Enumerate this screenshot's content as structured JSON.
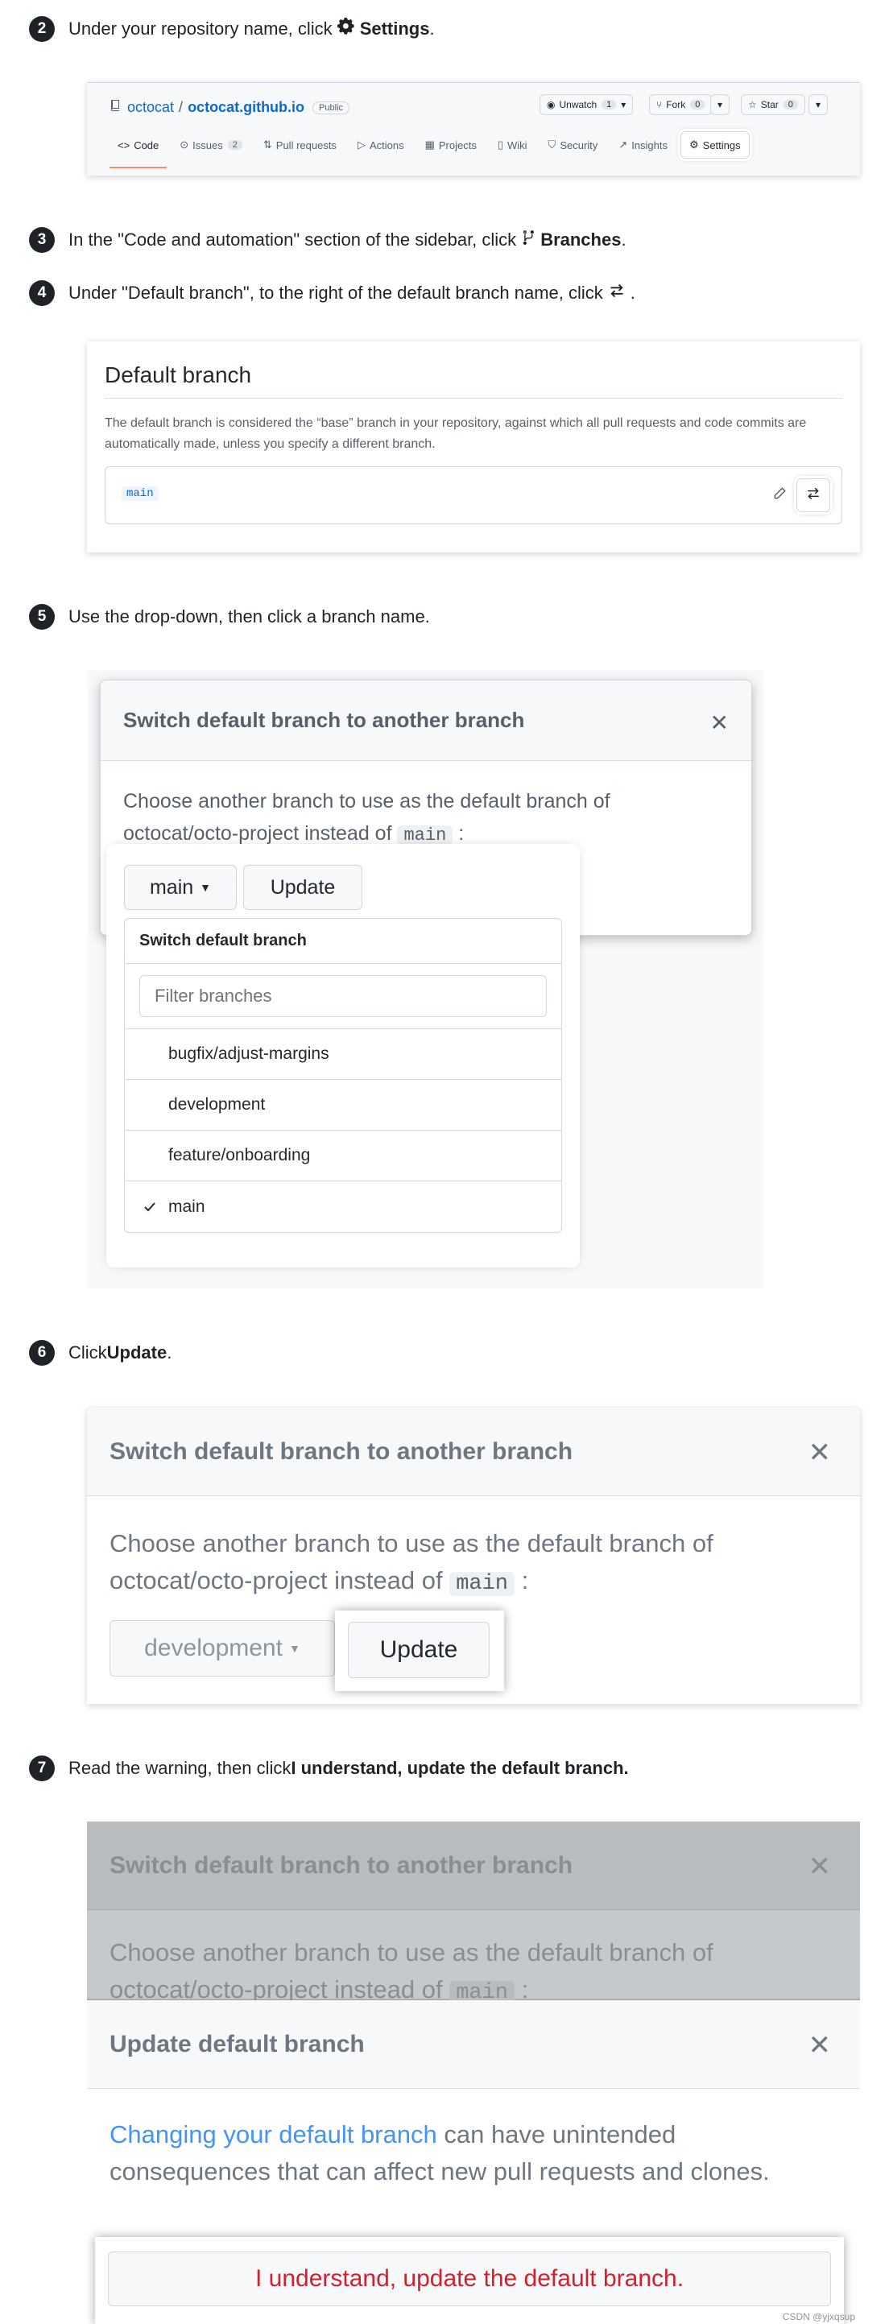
{
  "steps": [
    {
      "num": "2",
      "pre": "Under your repository name, click ",
      "bold": "Settings",
      "post": "."
    },
    {
      "num": "3",
      "pre": "In the \"Code and automation\" section of the sidebar, click ",
      "bold": "Branches",
      "post": "."
    },
    {
      "num": "4",
      "pre": "Under \"Default branch\", to the right of the default branch name, click ",
      "bold": "",
      "post": "."
    },
    {
      "num": "5",
      "pre": "Use the drop-down, then click a branch name.",
      "bold": "",
      "post": ""
    },
    {
      "num": "6",
      "pre": "Click ",
      "bold": "Update",
      "post": "."
    },
    {
      "num": "7",
      "pre": "Read the warning, then click ",
      "bold": "I understand, update the default branch.",
      "post": ""
    }
  ],
  "repo": {
    "owner": "octocat",
    "name": "octocat.github.io",
    "visibility": "Public",
    "unwatch_label": "Unwatch",
    "unwatch_count": "1",
    "fork_label": "Fork",
    "fork_count": "0",
    "star_label": "Star",
    "star_count": "0",
    "tabs": [
      {
        "label": "Code",
        "count": ""
      },
      {
        "label": "Issues",
        "count": "2"
      },
      {
        "label": "Pull requests",
        "count": ""
      },
      {
        "label": "Actions",
        "count": ""
      },
      {
        "label": "Projects",
        "count": ""
      },
      {
        "label": "Wiki",
        "count": ""
      },
      {
        "label": "Security",
        "count": ""
      },
      {
        "label": "Insights",
        "count": ""
      },
      {
        "label": "Settings",
        "count": ""
      }
    ]
  },
  "default_branch": {
    "heading": "Default branch",
    "description": "The default branch is considered the “base” branch in your repository, against which all pull requests and code commits are automatically made, unless you specify a different branch.",
    "branch": "main"
  },
  "switch_modal": {
    "title": "Switch default branch to another branch",
    "body_pre": "Choose another branch to use as the default branch of octocat/octo-project instead of ",
    "current": "main",
    "body_post": ":",
    "branch_button": "main",
    "update_button": "Update",
    "menu_title": "Switch default branch",
    "filter_placeholder": "Filter branches",
    "branches": [
      "bugfix/adjust-margins",
      "development",
      "feature/onboarding",
      "main"
    ]
  },
  "update_step": {
    "selected_branch": "development",
    "update_button": "Update"
  },
  "warning_modal": {
    "title": "Update default branch",
    "link_text": "Changing your default branch",
    "body": " can have unintended consequences that can affect new pull requests and clones.",
    "confirm_button": "I understand, update the default branch."
  },
  "watermark": "CSDN @yjxqsup",
  "colors": {
    "link": "#0969da",
    "danger": "#cf222e",
    "accent_tab": "#fd8c73"
  }
}
